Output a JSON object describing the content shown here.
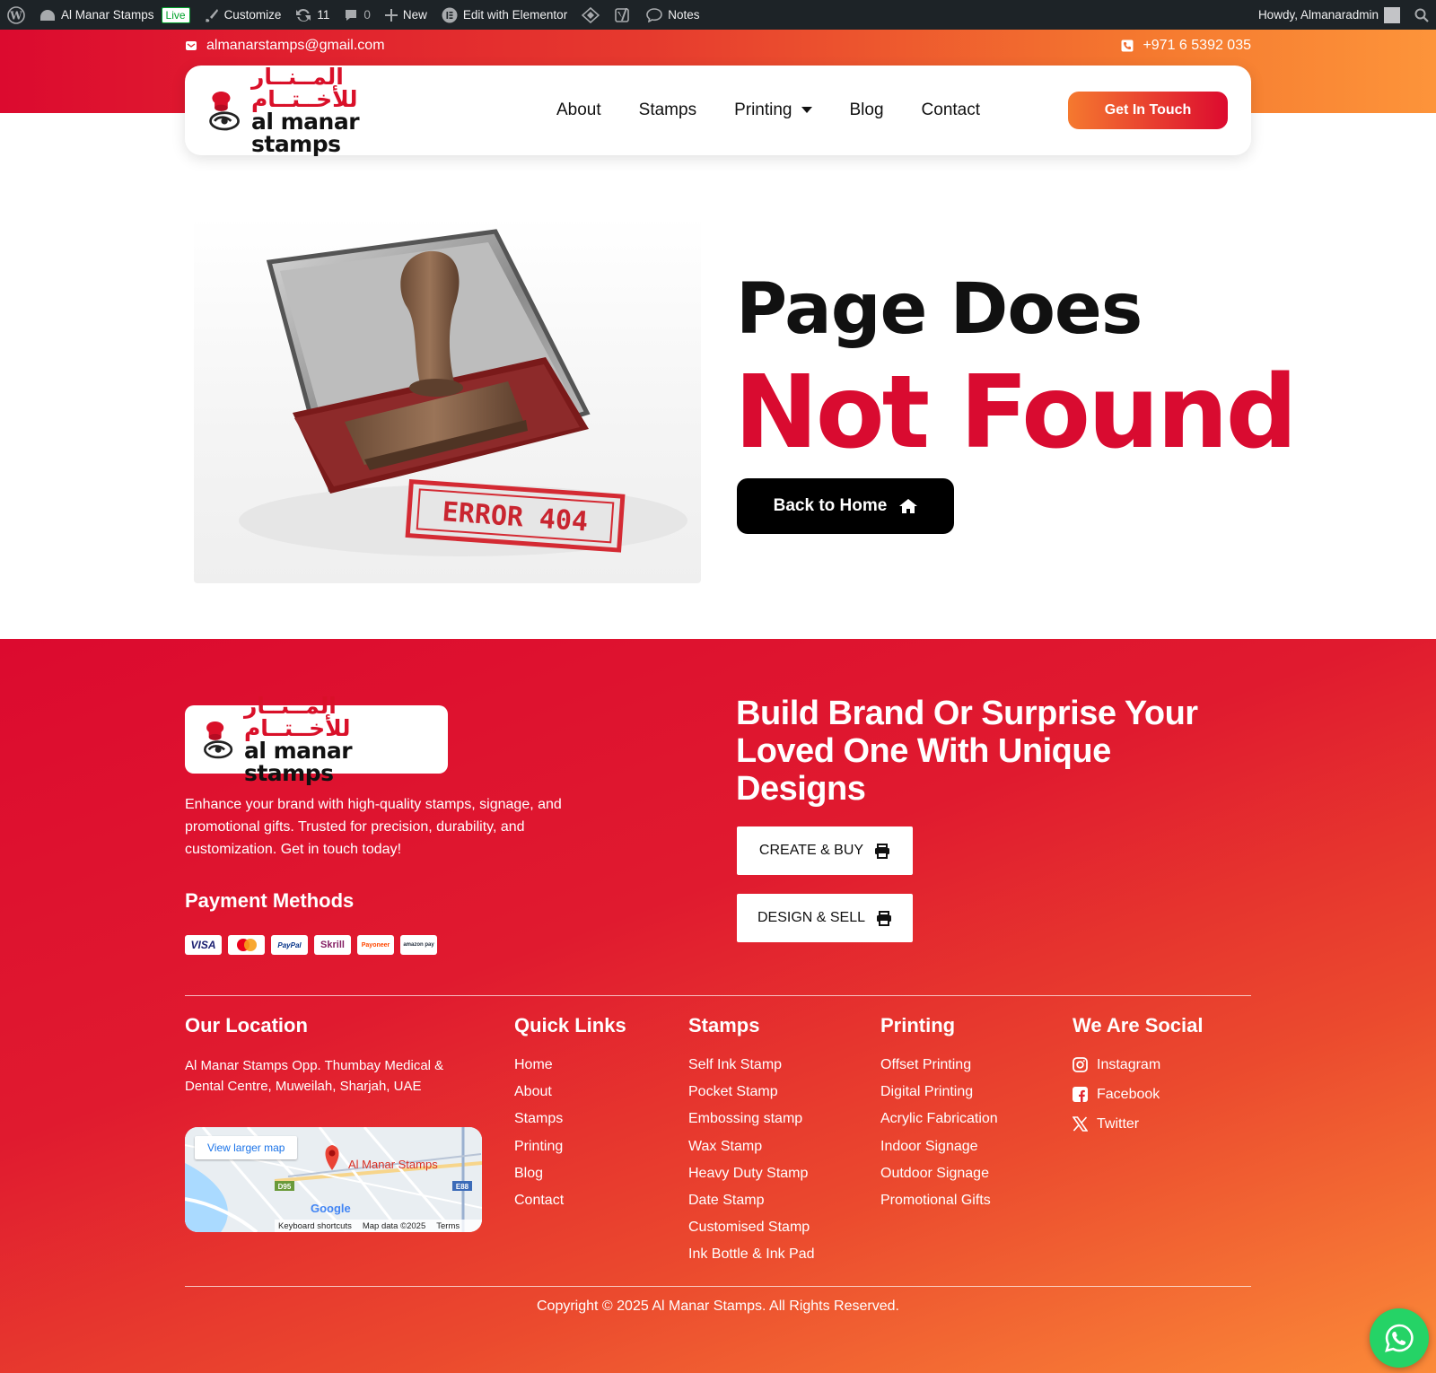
{
  "admin_bar": {
    "site_name": "Al Manar Stamps",
    "live_badge": "Live",
    "customize": "Customize",
    "updates_count": "11",
    "comments_count": "0",
    "new": "New",
    "elementor": "Edit with Elementor",
    "notes": "Notes",
    "howdy": "Howdy, Almanaradmin"
  },
  "topbar": {
    "email": "almanarstamps@gmail.com",
    "phone": "+971 6 5392 035"
  },
  "logo": {
    "arabic": "المــنــار للأخــتــام",
    "english": "al manar stamps"
  },
  "nav": {
    "items": [
      "About",
      "Stamps",
      "Printing",
      "Blog",
      "Contact"
    ],
    "cta": "Get In Touch"
  },
  "hero": {
    "image_label": "ERROR 404",
    "title_line1": "Page Does",
    "title_line2": "Not Found",
    "back_button": "Back to Home"
  },
  "footer": {
    "description": "Enhance your brand with high-quality stamps, signage, and promotional gifts. Trusted for precision, durability, and customization. Get in touch today!",
    "payment_title": "Payment Methods",
    "payment_methods": [
      "VISA",
      "Mastercard",
      "PayPal",
      "Skrill",
      "Payoneer",
      "amazon pay"
    ],
    "headline": "Build Brand Or Surprise Your Loved One With Unique Designs",
    "create_button": "CREATE & BUY",
    "design_button": "DESIGN & SELL",
    "location": {
      "title": "Our Location",
      "address": "Al Manar Stamps Opp. Thumbay Medical & Dental Centre, Muweilah, Sharjah, UAE",
      "map_button": "View larger map",
      "map_label": "Al Manar Stamps",
      "map_google": "Google",
      "map_shortcuts": "Keyboard shortcuts",
      "map_data": "Map data ©2025",
      "map_terms": "Terms",
      "road1": "D95",
      "road2": "E88"
    },
    "quick_links": {
      "title": "Quick Links",
      "items": [
        "Home",
        "About",
        "Stamps",
        "Printing",
        "Blog",
        "Contact"
      ]
    },
    "stamps": {
      "title": "Stamps",
      "items": [
        "Self Ink Stamp",
        "Pocket Stamp",
        "Embossing stamp",
        "Wax Stamp",
        "Heavy Duty Stamp",
        "Date Stamp",
        "Customised Stamp",
        "Ink Bottle & Ink Pad"
      ]
    },
    "printing": {
      "title": "Printing",
      "items": [
        "Offset Printing",
        "Digital Printing",
        "Acrylic Fabrication",
        "Indoor Signage",
        "Outdoor Signage",
        "Promotional Gifts"
      ]
    },
    "social": {
      "title": "We Are Social",
      "items": [
        "Instagram",
        "Facebook",
        "Twitter"
      ]
    },
    "copyright": "Copyright © 2025 Al Manar Stamps. All Rights Reserved."
  },
  "colors": {
    "brand_red": "#dc0a2f",
    "brand_orange": "#fd943a",
    "whatsapp": "#25d366"
  }
}
